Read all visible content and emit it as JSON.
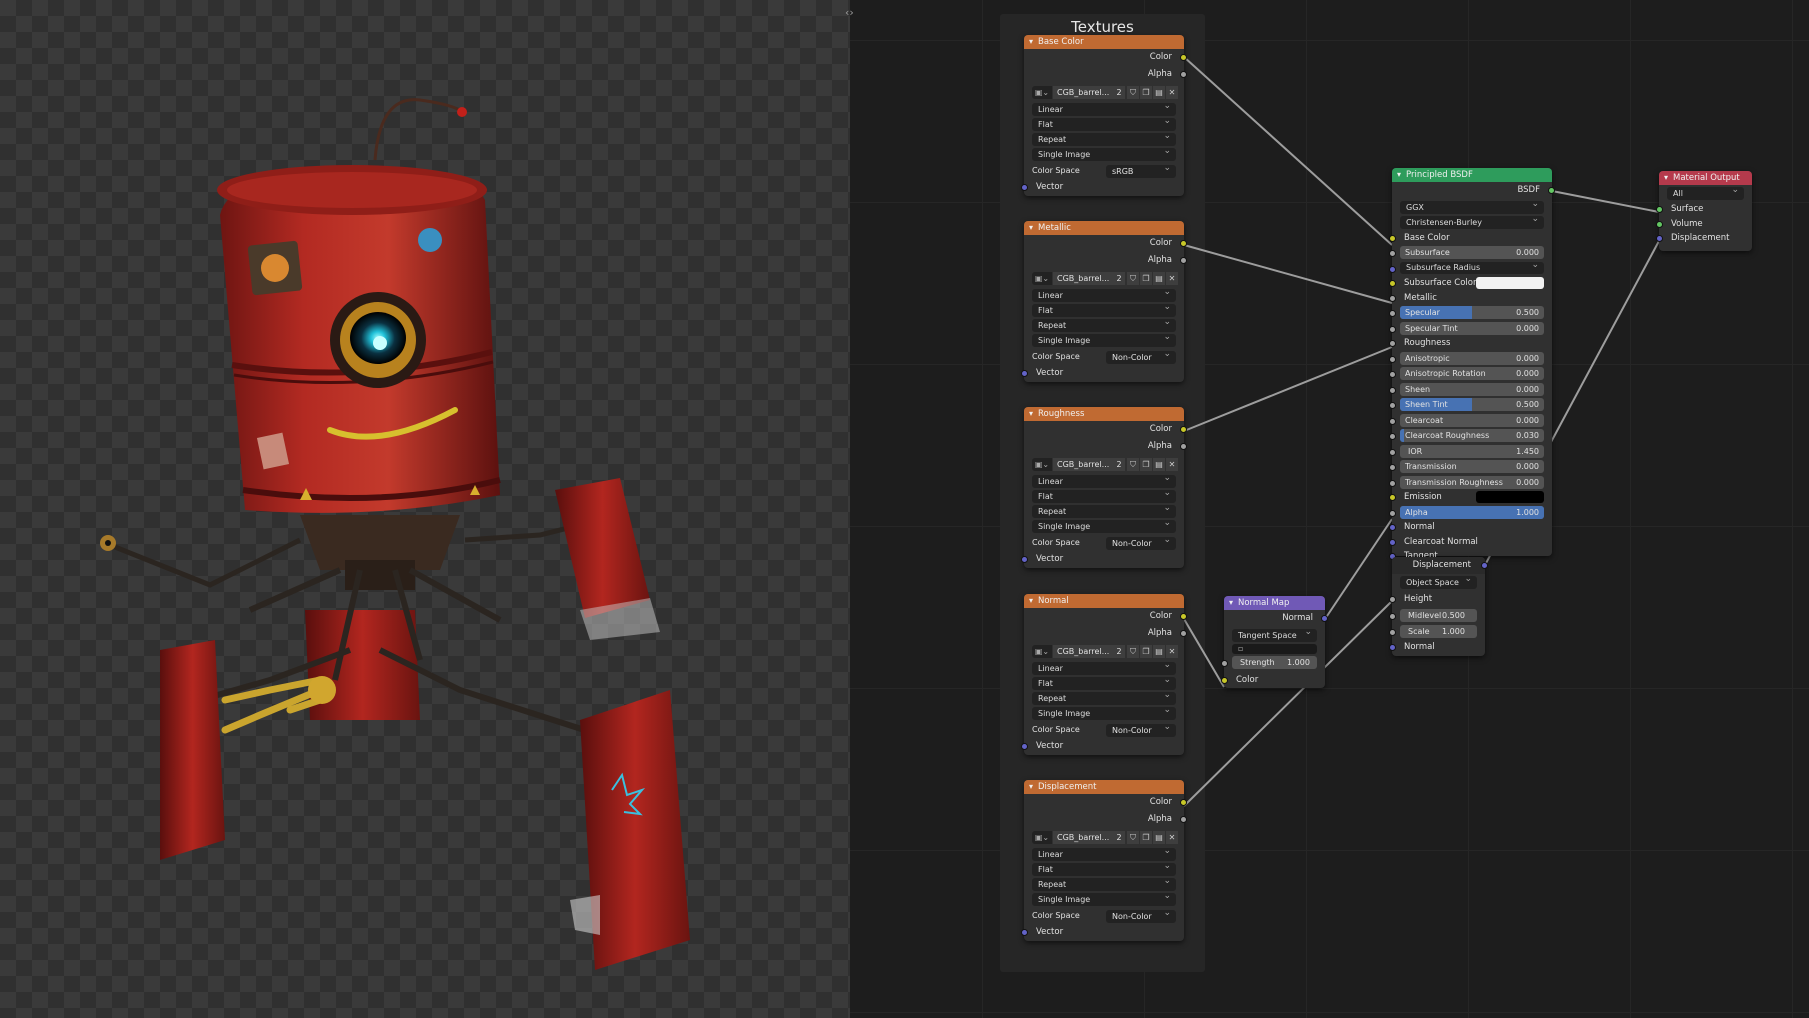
{
  "frame": {
    "title": "Textures"
  },
  "texture_nodes": [
    {
      "id": "base",
      "header": "Base Color",
      "outputs": [
        "Color",
        "Alpha"
      ],
      "image_name": "CGB_barrel...",
      "users": "2",
      "interpolation": "Linear",
      "projection": "Flat",
      "extension": "Repeat",
      "source": "Single Image",
      "color_space_label": "Color Space",
      "color_space": "sRGB",
      "input": "Vector"
    },
    {
      "id": "metallic",
      "header": "Metallic",
      "outputs": [
        "Color",
        "Alpha"
      ],
      "image_name": "CGB_barrel...",
      "users": "2",
      "interpolation": "Linear",
      "projection": "Flat",
      "extension": "Repeat",
      "source": "Single Image",
      "color_space_label": "Color Space",
      "color_space": "Non-Color",
      "input": "Vector"
    },
    {
      "id": "rough",
      "header": "Roughness",
      "outputs": [
        "Color",
        "Alpha"
      ],
      "image_name": "CGB_barrel...",
      "users": "2",
      "interpolation": "Linear",
      "projection": "Flat",
      "extension": "Repeat",
      "source": "Single Image",
      "color_space_label": "Color Space",
      "color_space": "Non-Color",
      "input": "Vector"
    },
    {
      "id": "normal",
      "header": "Normal",
      "outputs": [
        "Color",
        "Alpha"
      ],
      "image_name": "CGB_barrel...",
      "users": "2",
      "interpolation": "Linear",
      "projection": "Flat",
      "extension": "Repeat",
      "source": "Single Image",
      "color_space_label": "Color Space",
      "color_space": "Non-Color",
      "input": "Vector"
    },
    {
      "id": "disp",
      "header": "Displacement",
      "outputs": [
        "Color",
        "Alpha"
      ],
      "image_name": "CGB_barrel...",
      "users": "2",
      "interpolation": "Linear",
      "projection": "Flat",
      "extension": "Repeat",
      "source": "Single Image",
      "color_space_label": "Color Space",
      "color_space": "Non-Color",
      "input": "Vector"
    }
  ],
  "normal_map": {
    "header": "Normal Map",
    "output": "Normal",
    "space": "Tangent Space",
    "uv": "",
    "strength_label": "Strength",
    "strength": "1.000",
    "input": "Color"
  },
  "bsdf": {
    "header": "Principled BSDF",
    "output": "BSDF",
    "distribution": "GGX",
    "subsurface_method": "Christensen-Burley",
    "base_color": "Base Color",
    "subsurface": {
      "label": "Subsurface",
      "value": "0.000",
      "fill": 0
    },
    "subsurface_radius": "Subsurface Radius",
    "subsurface_color": "Subsurface Color",
    "metallic": "Metallic",
    "specular": {
      "label": "Specular",
      "value": "0.500",
      "fill": 0.5
    },
    "specular_tint": {
      "label": "Specular Tint",
      "value": "0.000",
      "fill": 0
    },
    "roughness": "Roughness",
    "anisotropic": {
      "label": "Anisotropic",
      "value": "0.000",
      "fill": 0
    },
    "anisotropic_rotation": {
      "label": "Anisotropic Rotation",
      "value": "0.000",
      "fill": 0
    },
    "sheen": {
      "label": "Sheen",
      "value": "0.000",
      "fill": 0
    },
    "sheen_tint": {
      "label": "Sheen Tint",
      "value": "0.500",
      "fill": 0.5
    },
    "clearcoat": {
      "label": "Clearcoat",
      "value": "0.000",
      "fill": 0
    },
    "clearcoat_roughness": {
      "label": "Clearcoat Roughness",
      "value": "0.030",
      "fill": 0.03
    },
    "ior": {
      "label": "IOR",
      "value": "1.450"
    },
    "transmission": {
      "label": "Transmission",
      "value": "0.000",
      "fill": 0
    },
    "transmission_roughness": {
      "label": "Transmission Roughness",
      "value": "0.000",
      "fill": 0
    },
    "emission": "Emission",
    "alpha": {
      "label": "Alpha",
      "value": "1.000",
      "fill": 1
    },
    "normal": "Normal",
    "clearcoat_normal": "Clearcoat Normal",
    "tangent": "Tangent"
  },
  "displacement_node": {
    "header": "Displacement",
    "space": "Object Space",
    "height": "Height",
    "midlevel_label": "Midlevel",
    "midlevel": "0.500",
    "scale_label": "Scale",
    "scale": "1.000",
    "normal": "Normal"
  },
  "material_output": {
    "header": "Material Output",
    "target": "All",
    "inputs": [
      "Surface",
      "Volume",
      "Displacement"
    ]
  },
  "colors": {
    "texture_header": "#c06a32",
    "shader_header": "#2e9c5c",
    "vector_header": "#7059b6",
    "output_header": "#b53a4c",
    "slider_fill": "#4772b3",
    "link": "#b4b4b4"
  }
}
